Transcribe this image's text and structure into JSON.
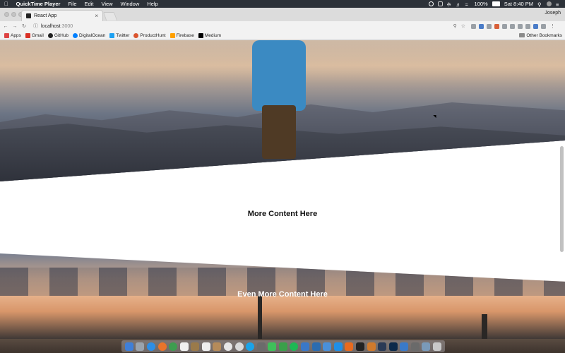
{
  "menubar": {
    "app_name": "QuickTime Player",
    "menus": [
      "File",
      "Edit",
      "View",
      "Window",
      "Help"
    ],
    "battery": "100%",
    "clock": "Sat 8:40 PM"
  },
  "browser": {
    "tab_title": "React App",
    "user": "Joseph",
    "url_host": "localhost",
    "url_port": ":3000"
  },
  "bookmarks": {
    "items": [
      "Apps",
      "Gmail",
      "GitHub",
      "DigitalOcean",
      "Twitter",
      "ProductHunt",
      "Firebase",
      "Medium"
    ],
    "other": "Other Bookmarks"
  },
  "page": {
    "more_content": "More Content Here",
    "even_more_content": "Even More Content Here"
  },
  "colors": {
    "menubar_bg": "#2c3138",
    "chrome_bg": "#f2f2f2",
    "page_bg": "#ffffff"
  }
}
